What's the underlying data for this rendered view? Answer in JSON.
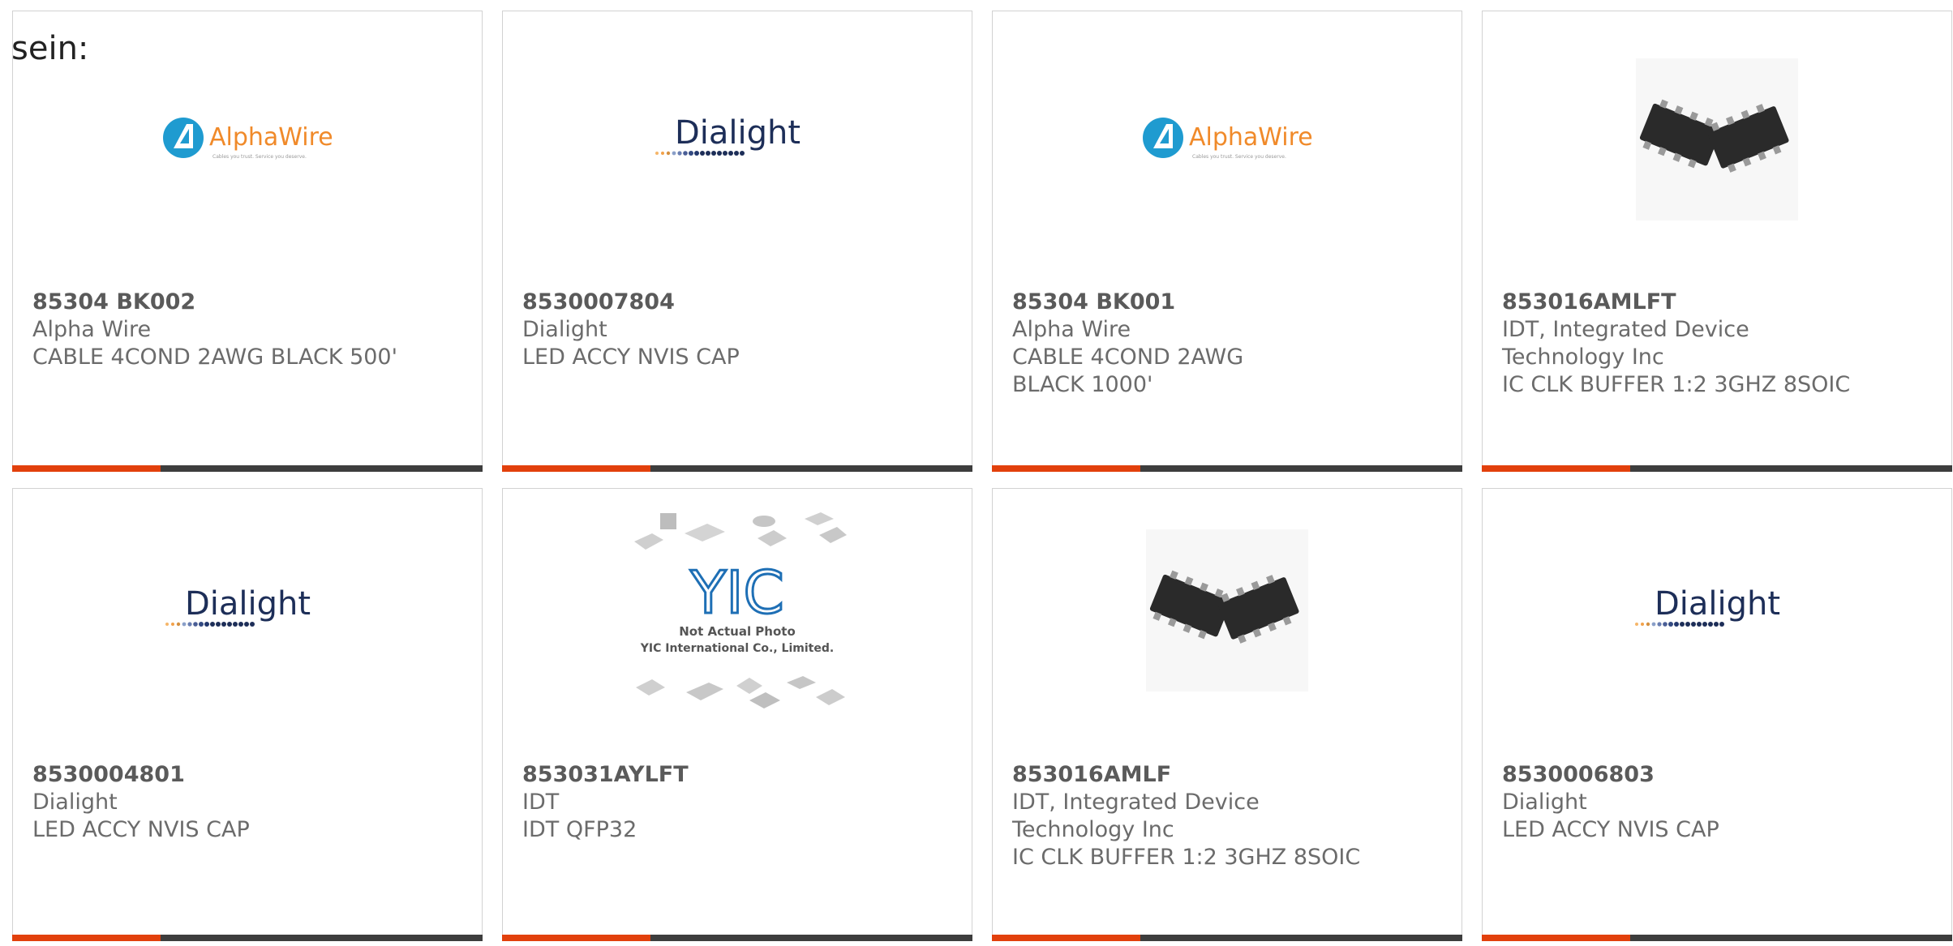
{
  "heading": "sein:",
  "colors": {
    "accent_bar": "#e2400c",
    "dark_bar": "#3d3d3d",
    "alphawire_blue": "#1f9bd0",
    "alphawire_orange": "#f08a2a",
    "dialight_navy": "#1d2e58",
    "yic_blue": "#1e6fb5"
  },
  "products": [
    {
      "part_number": "85304 BK002",
      "manufacturer": "Alpha Wire",
      "description": "CABLE 4COND 2AWG BLACK 500'",
      "image": "alphawire-logo",
      "logo_text": "AlphaWire",
      "logo_tagline": "Cables you trust. Service you deserve."
    },
    {
      "part_number": "8530007804",
      "manufacturer": "Dialight",
      "description": "LED ACCY NVIS CAP",
      "image": "dialight-logo",
      "logo_text": "Dialight"
    },
    {
      "part_number": "85304 BK001",
      "manufacturer": "Alpha Wire",
      "description": "CABLE 4COND 2AWG BLACK 1000'",
      "image": "alphawire-logo",
      "logo_text": "AlphaWire",
      "logo_tagline": "Cables you trust. Service you deserve."
    },
    {
      "part_number": "853016AMLFT",
      "manufacturer": "IDT, Integrated Device Technology Inc",
      "description": "IC CLK BUFFER 1:2 3GHZ 8SOIC",
      "image": "soic-chip-photo"
    },
    {
      "part_number": "8530004801",
      "manufacturer": "Dialight",
      "description": "LED ACCY NVIS CAP",
      "image": "dialight-logo",
      "logo_text": "Dialight"
    },
    {
      "part_number": "853031AYLFT",
      "manufacturer": "IDT",
      "description": "IDT QFP32",
      "image": "yic-placeholder",
      "logo_text": "YIC",
      "photo_note": "Not Actual Photo",
      "photo_company": "YIC International Co., Limited."
    },
    {
      "part_number": "853016AMLF",
      "manufacturer": "IDT, Integrated Device Technology Inc",
      "description": "IC CLK BUFFER 1:2 3GHZ 8SOIC",
      "image": "soic-chip-photo"
    },
    {
      "part_number": "8530006803",
      "manufacturer": "Dialight",
      "description": "LED ACCY NVIS CAP",
      "image": "dialight-logo",
      "logo_text": "Dialight"
    }
  ]
}
